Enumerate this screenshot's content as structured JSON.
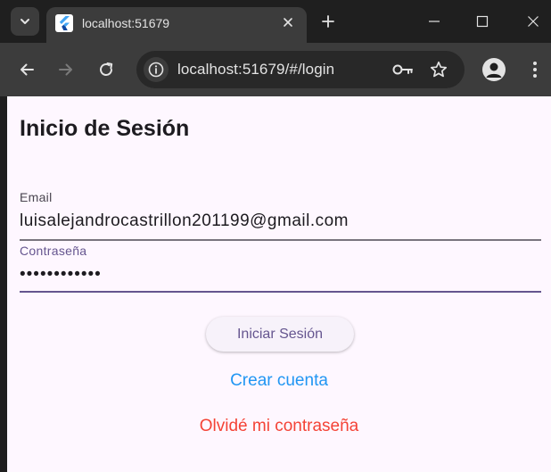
{
  "browser": {
    "tab": {
      "title": "localhost:51679"
    },
    "address_bar": {
      "url": "localhost:51679/#/login"
    },
    "icons": {
      "tab_search": "chevron-down-icon",
      "favicon": "flutter-icon",
      "tab_close": "close-icon",
      "new_tab": "plus-icon",
      "minimize": "minimize-icon",
      "maximize": "maximize-icon",
      "close": "close-icon",
      "back": "arrow-left-icon",
      "forward": "arrow-right-icon",
      "reload": "reload-icon",
      "site_info": "info-icon",
      "password_manager": "key-icon",
      "bookmark": "star-icon",
      "profile": "person-icon",
      "menu": "more-vertical-icon"
    }
  },
  "login": {
    "title": "Inicio de Sesión",
    "email": {
      "label": "Email",
      "value": "luisalejandrocastrillon201199@gmail.com"
    },
    "password": {
      "label": "Contraseña",
      "value": "••••••••••••"
    },
    "submit_label": "Iniciar Sesión",
    "create_account_label": "Crear cuenta",
    "forgot_password_label": "Olvidé mi contraseña"
  },
  "colors": {
    "page_background": "#fef7ff",
    "primary": "#65558f",
    "create_link": "#2196f3",
    "forgot_link": "#f44336",
    "browser_frame": "#1f1f1f",
    "browser_toolbar": "#3c3c3c"
  }
}
